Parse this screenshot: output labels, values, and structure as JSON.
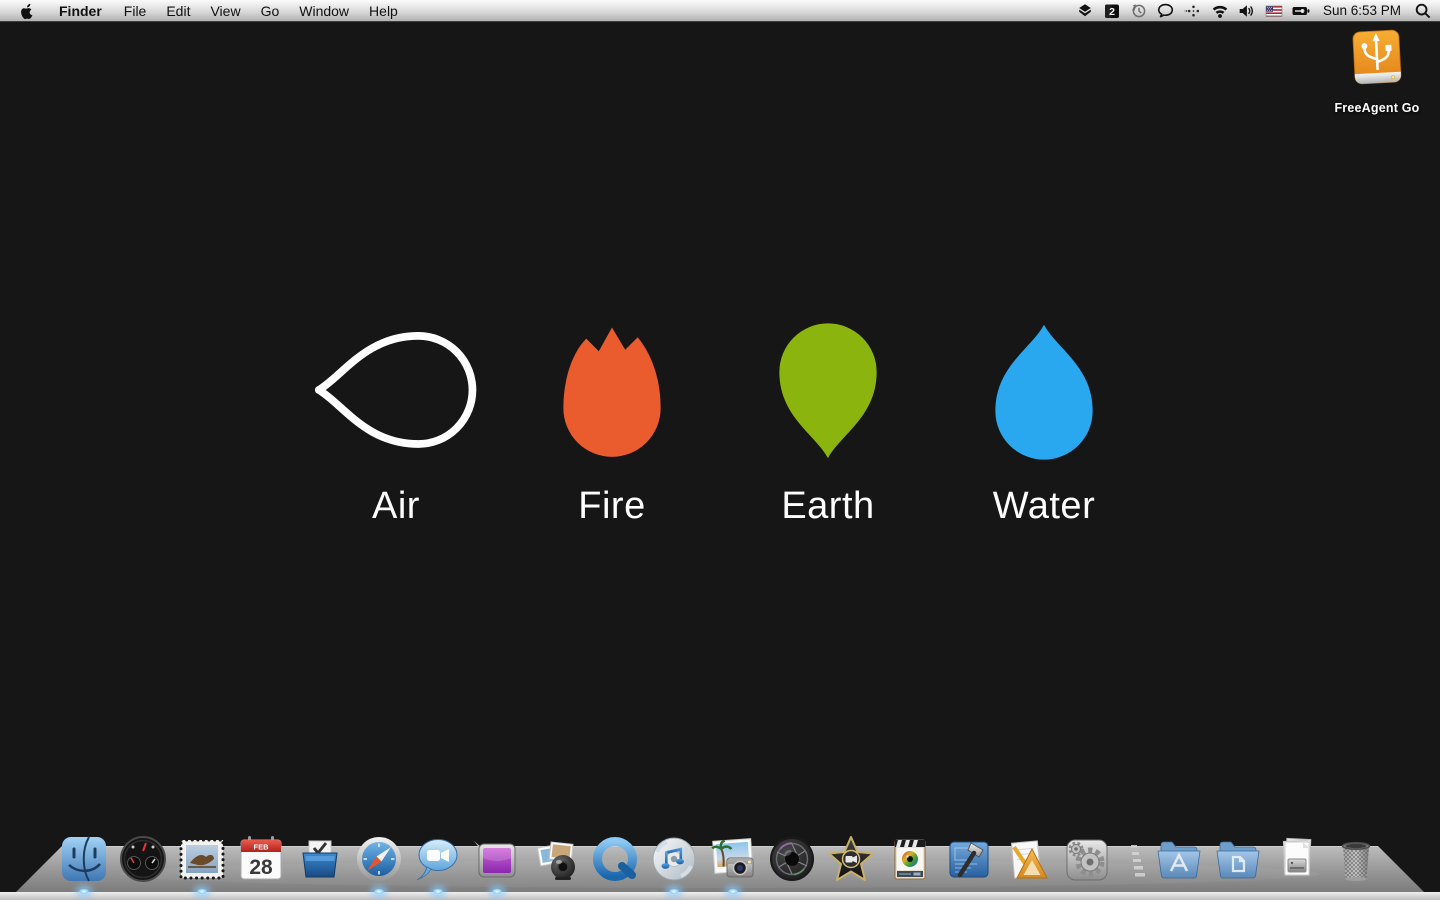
{
  "menubar": {
    "items": [
      "Finder",
      "File",
      "Edit",
      "View",
      "Go",
      "Window",
      "Help"
    ],
    "badge_count": "2",
    "clock": "Sun 6:53 PM",
    "status_icons": [
      "dropbox",
      "badge-2",
      "time-machine",
      "chat-bubble",
      "dots-sparkle",
      "wifi",
      "volume",
      "us-flag",
      "battery-charging",
      "spotlight"
    ]
  },
  "desktop": {
    "wallpaper_color": "#161616",
    "drive_label": "FreeAgent Go",
    "drive_color": "#f0941e",
    "elements": [
      {
        "name": "Air",
        "color": "#ffffff",
        "style": "outline",
        "shape": "drop-pointing-left"
      },
      {
        "name": "Fire",
        "color": "#ea5b2d",
        "style": "fill",
        "shape": "tulip-flame"
      },
      {
        "name": "Earth",
        "color": "#8cb40f",
        "style": "fill",
        "shape": "drop-pointing-down"
      },
      {
        "name": "Water",
        "color": "#29a7ef",
        "style": "fill",
        "shape": "drop-pointing-up"
      }
    ]
  },
  "dock": {
    "calendar": {
      "month": "FEB",
      "day": "28"
    },
    "items": [
      {
        "id": "finder",
        "name": "Finder",
        "running": true
      },
      {
        "id": "dashboard",
        "name": "Dashboard",
        "running": false
      },
      {
        "id": "mail",
        "name": "Mail",
        "running": true
      },
      {
        "id": "ical",
        "name": "iCal",
        "running": false
      },
      {
        "id": "things",
        "name": "Things",
        "running": false
      },
      {
        "id": "safari",
        "name": "Safari",
        "running": true
      },
      {
        "id": "ichat",
        "name": "iChat",
        "running": true
      },
      {
        "id": "purple-app",
        "name": "Purple display app",
        "running": true
      },
      {
        "id": "photo-booth",
        "name": "Photo Booth",
        "running": false
      },
      {
        "id": "quicktime",
        "name": "QuickTime Player",
        "running": false
      },
      {
        "id": "itunes",
        "name": "iTunes",
        "running": true
      },
      {
        "id": "iphoto",
        "name": "iPhoto",
        "running": true
      },
      {
        "id": "aperture",
        "name": "Aperture",
        "running": false
      },
      {
        "id": "imovie",
        "name": "iMovie",
        "running": false
      },
      {
        "id": "video-eye",
        "name": "Video effects app",
        "running": false
      },
      {
        "id": "xcode",
        "name": "Xcode",
        "running": false
      },
      {
        "id": "interface-builder",
        "name": "Interface Builder",
        "running": false
      },
      {
        "id": "system-preferences",
        "name": "System Preferences",
        "running": false
      },
      {
        "id": "separator",
        "name": "Separator",
        "running": false
      },
      {
        "id": "applications-folder",
        "name": "Applications",
        "running": false
      },
      {
        "id": "documents-folder",
        "name": "Documents",
        "running": false
      },
      {
        "id": "documents-stack",
        "name": "Documents Stack",
        "running": false
      },
      {
        "id": "trash",
        "name": "Trash",
        "running": false
      }
    ]
  }
}
